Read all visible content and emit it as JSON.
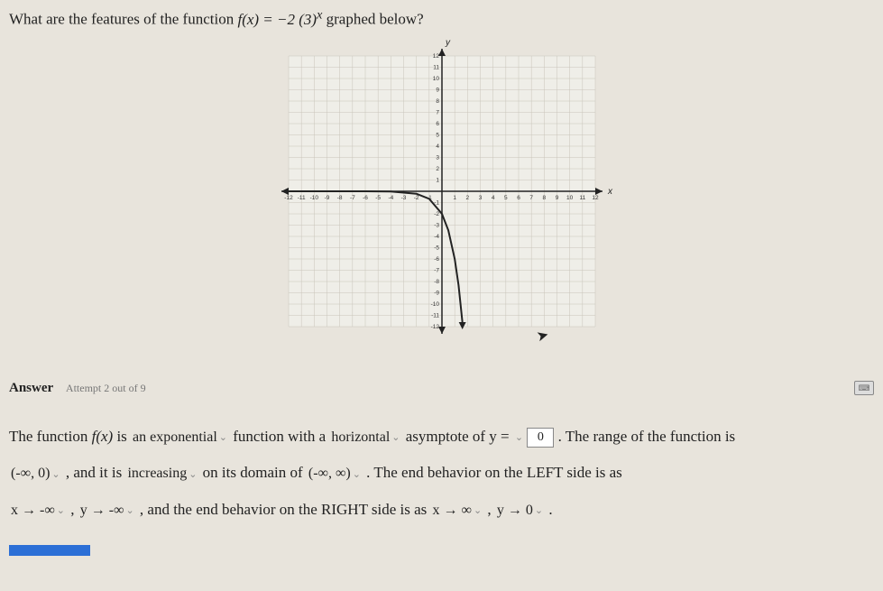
{
  "question": {
    "prefix": "What are the features of the function ",
    "fn_left": "f(x) = −2 (3)",
    "fn_exp": "x",
    "suffix": " graphed below?"
  },
  "chart_data": {
    "type": "line",
    "title": "",
    "xlabel": "x",
    "ylabel": "y",
    "xlim": [
      -12,
      12
    ],
    "ylim": [
      -12,
      12
    ],
    "x_ticks": [
      -12,
      -11,
      -10,
      -9,
      -8,
      -7,
      -6,
      -5,
      -4,
      -3,
      -2,
      -1,
      1,
      2,
      3,
      4,
      5,
      6,
      7,
      8,
      9,
      10,
      11,
      12
    ],
    "y_ticks": [
      -12,
      -11,
      -10,
      -9,
      -8,
      -7,
      -6,
      -5,
      -4,
      -3,
      -2,
      -1,
      1,
      2,
      3,
      4,
      5,
      6,
      7,
      8,
      9,
      10,
      11,
      12
    ],
    "series": [
      {
        "name": "f(x) = -2(3)^x",
        "x": [
          -12,
          -10,
          -8,
          -6,
          -4,
          -2,
          -1,
          0,
          0.5,
          1,
          1.3,
          1.6
        ],
        "values": [
          0,
          0,
          0,
          0,
          -0.02,
          -0.22,
          -0.67,
          -2,
          -3.46,
          -6,
          -8.33,
          -11.6
        ]
      }
    ]
  },
  "answer_header": {
    "label": "Answer",
    "attempt": "Attempt 2 out of 9"
  },
  "fill": {
    "l1a": "The function ",
    "fn": "f(x)",
    "l1b": " is ",
    "d1": "an exponential",
    "l1c": " function with a ",
    "d2": "horizontal",
    "l1d": " asymptote of  y = ",
    "input1": "0",
    "l1e": ". The range of the function is",
    "d3": "(-∞, 0)",
    "l2a": " , and it is ",
    "d4": "increasing",
    "l2b": " on its domain of ",
    "d5": "(-∞, ∞)",
    "l2c": " . The end behavior on the LEFT side is as",
    "d6": "x → -∞",
    "l3a": " , ",
    "d7": "y → -∞",
    "l3b": " , and the end behavior on the RIGHT side is as ",
    "d8": "x → ∞",
    "l3c": " , ",
    "d9": "y → 0",
    "l3d": " ."
  }
}
